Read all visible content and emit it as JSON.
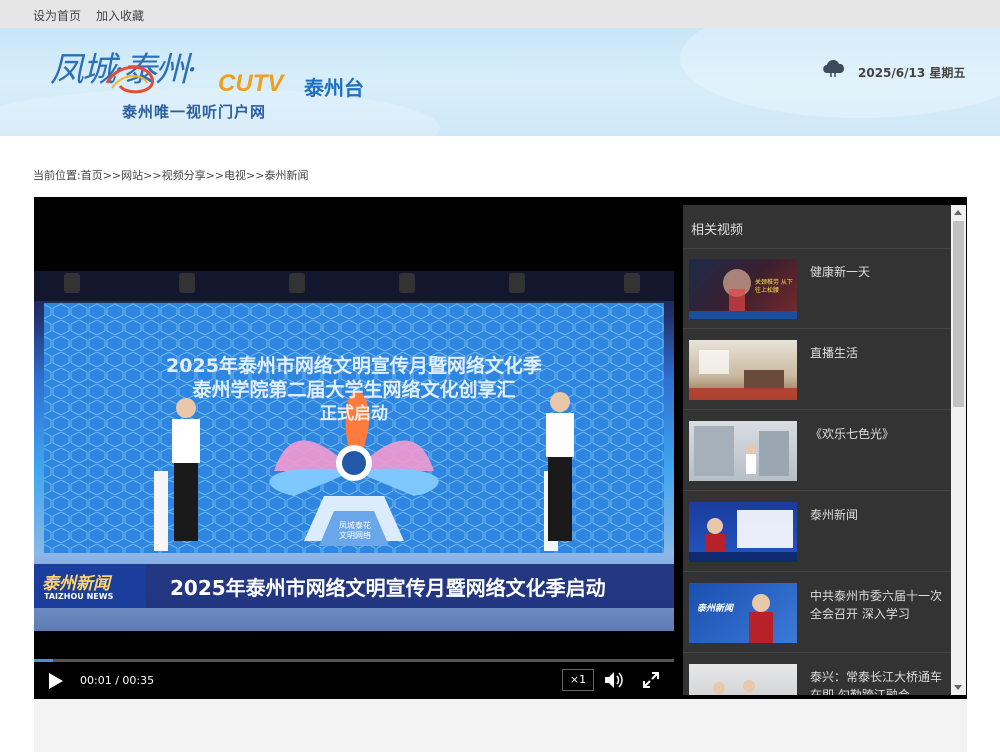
{
  "topbar": {
    "set_home": "设为首页",
    "add_favorite": "加入收藏"
  },
  "header": {
    "logo_script": "凤城·泰州·",
    "logo_cutv": "CUTV",
    "logo_station": "泰州台",
    "logo_sub": "泰州唯一视听门户网",
    "weather_icon": "cloud-icon",
    "date": "2025/6/13 星期五"
  },
  "breadcrumb": {
    "prefix": "当前位置:",
    "items": [
      "首页",
      "网站",
      "视频分享",
      "电视",
      "泰州新闻"
    ],
    "separator": ">>"
  },
  "player": {
    "video": {
      "stage_line1": "2025年泰州市网络文明宣传月暨网络文化季",
      "stage_line2": "泰州学院第二届大学生网络文化创享汇",
      "stage_line3": "正式启动",
      "stage_badge": "凤城泰花\n文明网络",
      "news_logo": "泰州新闻",
      "news_logo_en": "TAIZHOU NEWS",
      "caption": "2025年泰州市网络文明宣传月暨网络文化季启动"
    },
    "progress": 0.03,
    "time": "00:01 / 00:35",
    "speed": "×1",
    "icons": {
      "play": "play-icon",
      "volume": "volume-icon",
      "fullscreen": "fullscreen-icon"
    }
  },
  "related": {
    "title": "相关视频",
    "items": [
      {
        "label": "健康新一天",
        "thumb_text": "关颈椎劳 从下往上松腰"
      },
      {
        "label": "直播生活",
        "thumb_text": ""
      },
      {
        "label": "《欢乐七色光》",
        "thumb_text": ""
      },
      {
        "label": "泰州新闻",
        "thumb_text": ""
      },
      {
        "label": "中共泰州市委六届十一次全会召开 深入学习",
        "thumb_text": "泰州新闻"
      },
      {
        "label": "泰兴：常泰长江大桥通车在即 勾勒跨江融合",
        "thumb_text": ""
      }
    ]
  },
  "colors": {
    "accent": "#4a90e2",
    "header_bg": "#cfe8f7",
    "sidebar_bg": "#333333"
  }
}
